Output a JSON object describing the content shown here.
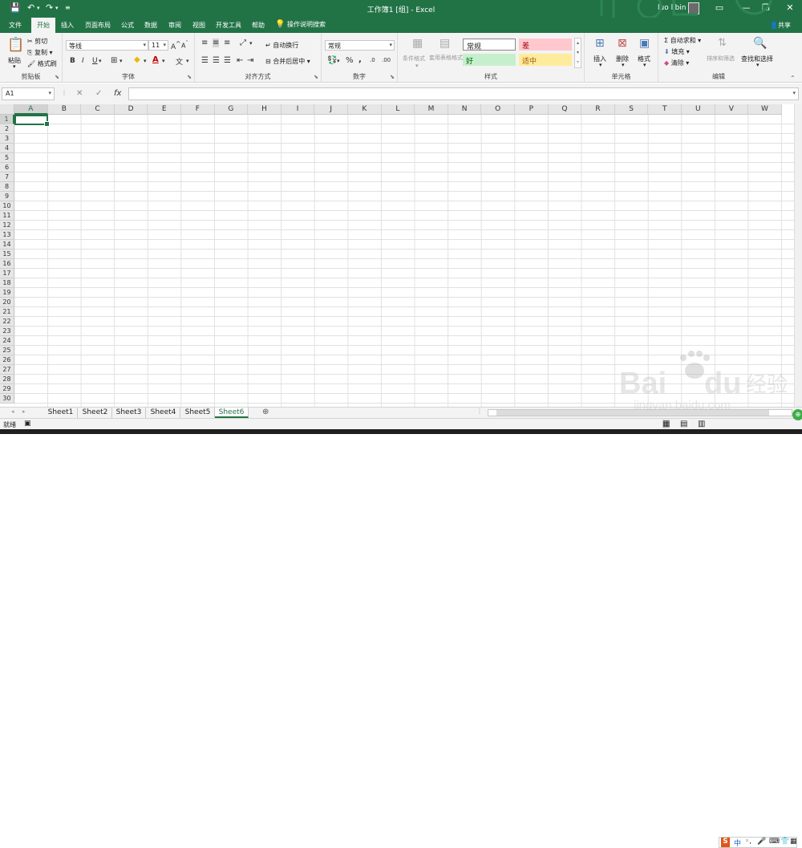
{
  "titlebar": {
    "title": "工作簿1 [组] - Excel",
    "user": "luo libin"
  },
  "tabs": [
    "文件",
    "开始",
    "插入",
    "页面布局",
    "公式",
    "数据",
    "审阅",
    "视图",
    "开发工具",
    "帮助"
  ],
  "tab_search": "操作说明搜索",
  "share": "共享",
  "ribbon": {
    "clipboard": {
      "label": "剪贴板",
      "paste": "粘贴",
      "cut": "剪切",
      "copy": "复制",
      "format_painter": "格式刷"
    },
    "font": {
      "label": "字体",
      "font_name": "等线",
      "font_size": "11",
      "bold": "B",
      "italic": "I",
      "underline": "U"
    },
    "alignment": {
      "label": "对齐方式",
      "wrap": "自动换行",
      "merge": "合并后居中"
    },
    "number": {
      "label": "数字",
      "format": "常规",
      "percent": "%",
      "comma": ","
    },
    "styles": {
      "label": "样式",
      "cond": "条件格式",
      "table": "套用表格格式",
      "normal": "常规",
      "bad": "差",
      "good": "好",
      "neutral": "适中"
    },
    "cells": {
      "label": "单元格",
      "insert": "插入",
      "delete": "删除",
      "format": "格式"
    },
    "editing": {
      "label": "编辑",
      "autosum": "自动求和",
      "fill": "填充",
      "clear": "清除",
      "sort": "排序和筛选",
      "find": "查找和选择"
    }
  },
  "formula": {
    "namebox": "A1",
    "fx": "fx"
  },
  "columns": [
    "A",
    "B",
    "C",
    "D",
    "E",
    "F",
    "G",
    "H",
    "I",
    "J",
    "K",
    "L",
    "M",
    "N",
    "O",
    "P",
    "Q",
    "R",
    "S",
    "T",
    "U",
    "V",
    "W"
  ],
  "rows": [
    "1",
    "2",
    "3",
    "4",
    "5",
    "6",
    "7",
    "8",
    "9",
    "10",
    "11",
    "12",
    "13",
    "14",
    "15",
    "16",
    "17",
    "18",
    "19",
    "20",
    "21",
    "22",
    "23",
    "24",
    "25",
    "26",
    "27",
    "28",
    "29",
    "30"
  ],
  "sheets": [
    "Sheet1",
    "Sheet2",
    "Sheet3",
    "Sheet4",
    "Sheet5",
    "Sheet6"
  ],
  "status": {
    "ready": "就绪"
  },
  "ime": {
    "s": "S",
    "zh": "中"
  },
  "colors": {
    "accent": "#217346",
    "bad_bg": "#ffc7ce",
    "bad_fg": "#9c0006",
    "good_bg": "#c6efce",
    "good_fg": "#006100",
    "neutral_bg": "#ffeb9c",
    "neutral_fg": "#9c5700"
  }
}
